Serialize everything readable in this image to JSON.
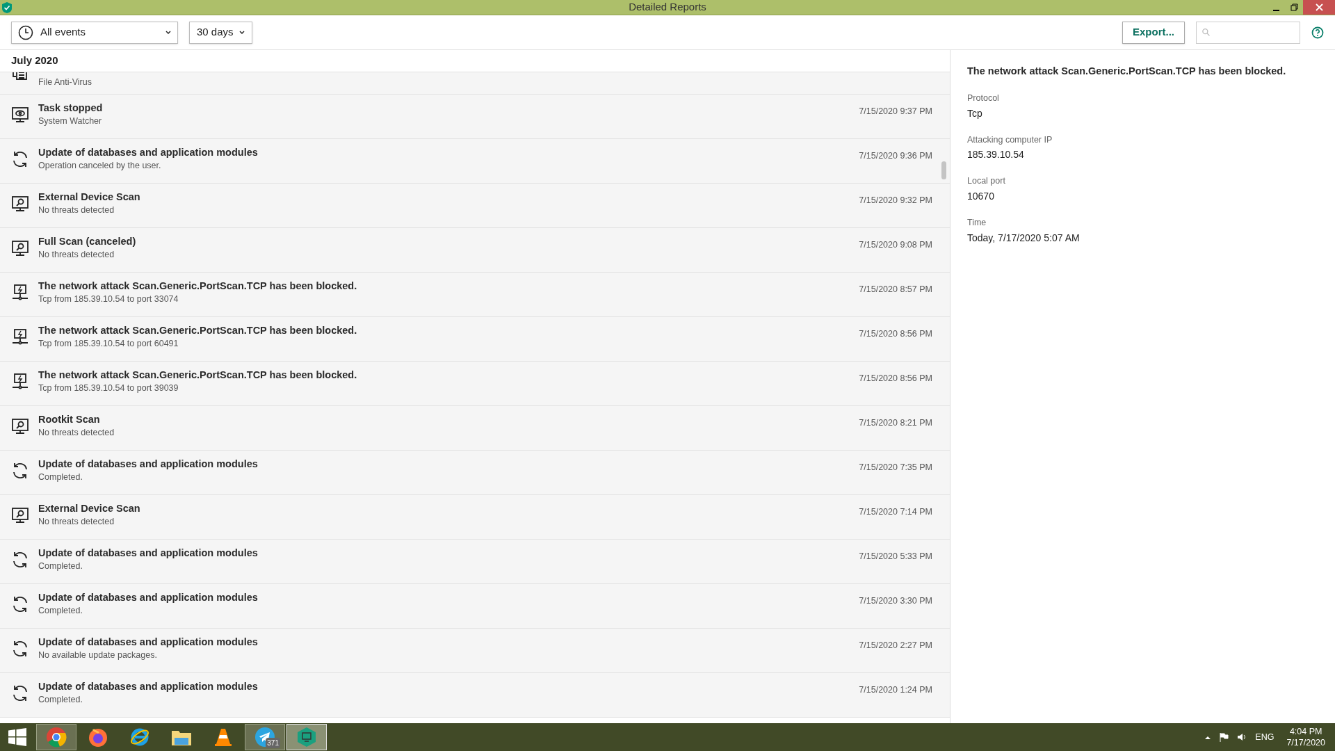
{
  "window": {
    "title": "Detailed Reports"
  },
  "toolbar": {
    "event_filter": "All events",
    "period_filter": "30 days",
    "export_button": "Export..."
  },
  "list": {
    "month": "July 2020",
    "events": [
      {
        "kind": "file",
        "subtitle": "File Anti-Virus"
      },
      {
        "kind": "watch",
        "title": "Task stopped",
        "subtitle": "System Watcher",
        "time": "7/15/2020 9:37 PM"
      },
      {
        "kind": "update",
        "title": "Update of databases and application modules",
        "subtitle": "Operation canceled by the user.",
        "time": "7/15/2020 9:36 PM"
      },
      {
        "kind": "scan",
        "title": "External Device Scan",
        "subtitle": "No threats detected",
        "time": "7/15/2020 9:32 PM"
      },
      {
        "kind": "scan",
        "title": "Full Scan (canceled)",
        "subtitle": "No threats detected",
        "time": "7/15/2020 9:08 PM"
      },
      {
        "kind": "network",
        "title": "The network attack Scan.Generic.PortScan.TCP has been blocked.",
        "subtitle": "Tcp from 185.39.10.54 to port 33074",
        "time": "7/15/2020 8:57 PM"
      },
      {
        "kind": "network",
        "title": "The network attack Scan.Generic.PortScan.TCP has been blocked.",
        "subtitle": "Tcp from 185.39.10.54 to port 60491",
        "time": "7/15/2020 8:56 PM"
      },
      {
        "kind": "network",
        "title": "The network attack Scan.Generic.PortScan.TCP has been blocked.",
        "subtitle": "Tcp from 185.39.10.54 to port 39039",
        "time": "7/15/2020 8:56 PM"
      },
      {
        "kind": "scan",
        "title": "Rootkit Scan",
        "subtitle": "No threats detected",
        "time": "7/15/2020 8:21 PM"
      },
      {
        "kind": "update",
        "title": "Update of databases and application modules",
        "subtitle": "Completed.",
        "time": "7/15/2020 7:35 PM"
      },
      {
        "kind": "scan",
        "title": "External Device Scan",
        "subtitle": "No threats detected",
        "time": "7/15/2020 7:14 PM"
      },
      {
        "kind": "update",
        "title": "Update of databases and application modules",
        "subtitle": "Completed.",
        "time": "7/15/2020 5:33 PM"
      },
      {
        "kind": "update",
        "title": "Update of databases and application modules",
        "subtitle": "Completed.",
        "time": "7/15/2020 3:30 PM"
      },
      {
        "kind": "update",
        "title": "Update of databases and application modules",
        "subtitle": "No available update packages.",
        "time": "7/15/2020 2:27 PM"
      },
      {
        "kind": "update",
        "title": "Update of databases and application modules",
        "subtitle": "Completed.",
        "time": "7/15/2020 1:24 PM"
      }
    ]
  },
  "details": {
    "title": "The network attack Scan.Generic.PortScan.TCP has been blocked.",
    "fields": [
      {
        "label": "Protocol",
        "value": "Tcp"
      },
      {
        "label": "Attacking computer IP",
        "value": "185.39.10.54"
      },
      {
        "label": "Local port",
        "value": "10670"
      },
      {
        "label": "Time",
        "value": "Today, 7/17/2020 5:07 AM"
      }
    ]
  },
  "taskbar": {
    "apps": [
      {
        "kind": "chrome",
        "highlighted": true,
        "selected": false
      },
      {
        "kind": "firefox",
        "highlighted": false,
        "selected": false
      },
      {
        "kind": "ie",
        "highlighted": false,
        "selected": false
      },
      {
        "kind": "explorer",
        "highlighted": false,
        "selected": false
      },
      {
        "kind": "vlc",
        "highlighted": false,
        "selected": false
      },
      {
        "kind": "telegram",
        "highlighted": true,
        "selected": false,
        "badge": "371"
      },
      {
        "kind": "shield",
        "highlighted": true,
        "selected": true
      }
    ],
    "language": "ENG",
    "clock_time": "4:04 PM",
    "clock_date": "7/17/2020"
  }
}
